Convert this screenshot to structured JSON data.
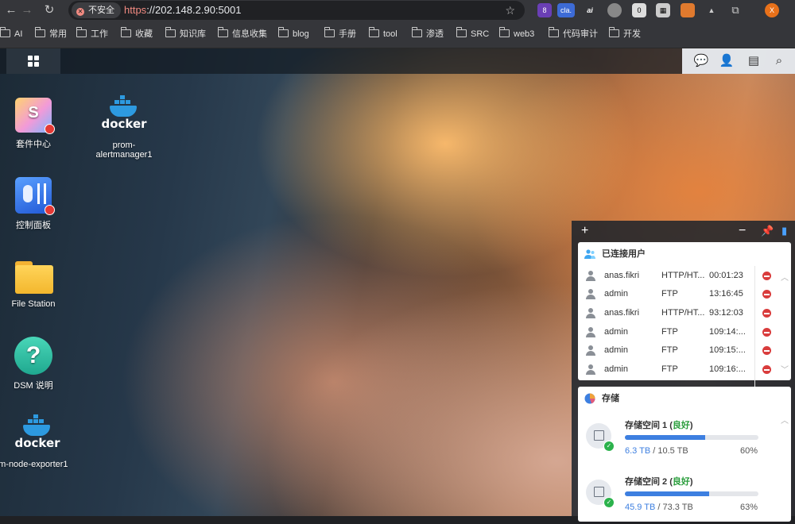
{
  "browser": {
    "security_label": "不安全",
    "url_scheme": "https",
    "url_rest": "://202.148.2.90:5001",
    "ext_badge": "8",
    "ext_cla": "cla.",
    "ext_zero": "0",
    "profile_initial": "X"
  },
  "bookmarks": [
    "AI",
    "常用",
    "工作",
    "收藏",
    "知识库",
    "信息收集",
    "blog",
    "手册",
    "tool",
    "渗透",
    "SRC",
    "web3",
    "代码审计",
    "开发"
  ],
  "desktop": {
    "icons": [
      {
        "label": "套件中心"
      },
      {
        "label": "prom-alertmanager1",
        "art": "docker"
      },
      {
        "label": "控制面板"
      },
      {
        "label": "File Station"
      },
      {
        "label": "DSM 说明",
        "art": "?"
      },
      {
        "label": "om-node-exporter1",
        "art": "docker"
      }
    ]
  },
  "widget": {
    "users_title": "已连接用户",
    "users": [
      {
        "name": "anas.fikri",
        "protocol": "HTTP/HT...",
        "time": "00:01:23"
      },
      {
        "name": "admin",
        "protocol": "FTP",
        "time": "13:16:45"
      },
      {
        "name": "anas.fikri",
        "protocol": "HTTP/HT...",
        "time": "93:12:03"
      },
      {
        "name": "admin",
        "protocol": "FTP",
        "time": "109:14:..."
      },
      {
        "name": "admin",
        "protocol": "FTP",
        "time": "109:15:..."
      },
      {
        "name": "admin",
        "protocol": "FTP",
        "time": "109:16:..."
      }
    ],
    "storage_title": "存储",
    "volumes": [
      {
        "name": "存储空间 1",
        "status": "良好",
        "used": "6.3 TB",
        "total": "10.5 TB",
        "percent_text": "60%",
        "percent": 60
      },
      {
        "name": "存储空间 2",
        "status": "良好",
        "used": "45.9 TB",
        "total": "73.3 TB",
        "percent_text": "63%",
        "percent": 63
      }
    ]
  },
  "colors": {
    "accent": "#3d7fe0",
    "good": "#2a9d3c",
    "danger": "#d93c3c"
  }
}
